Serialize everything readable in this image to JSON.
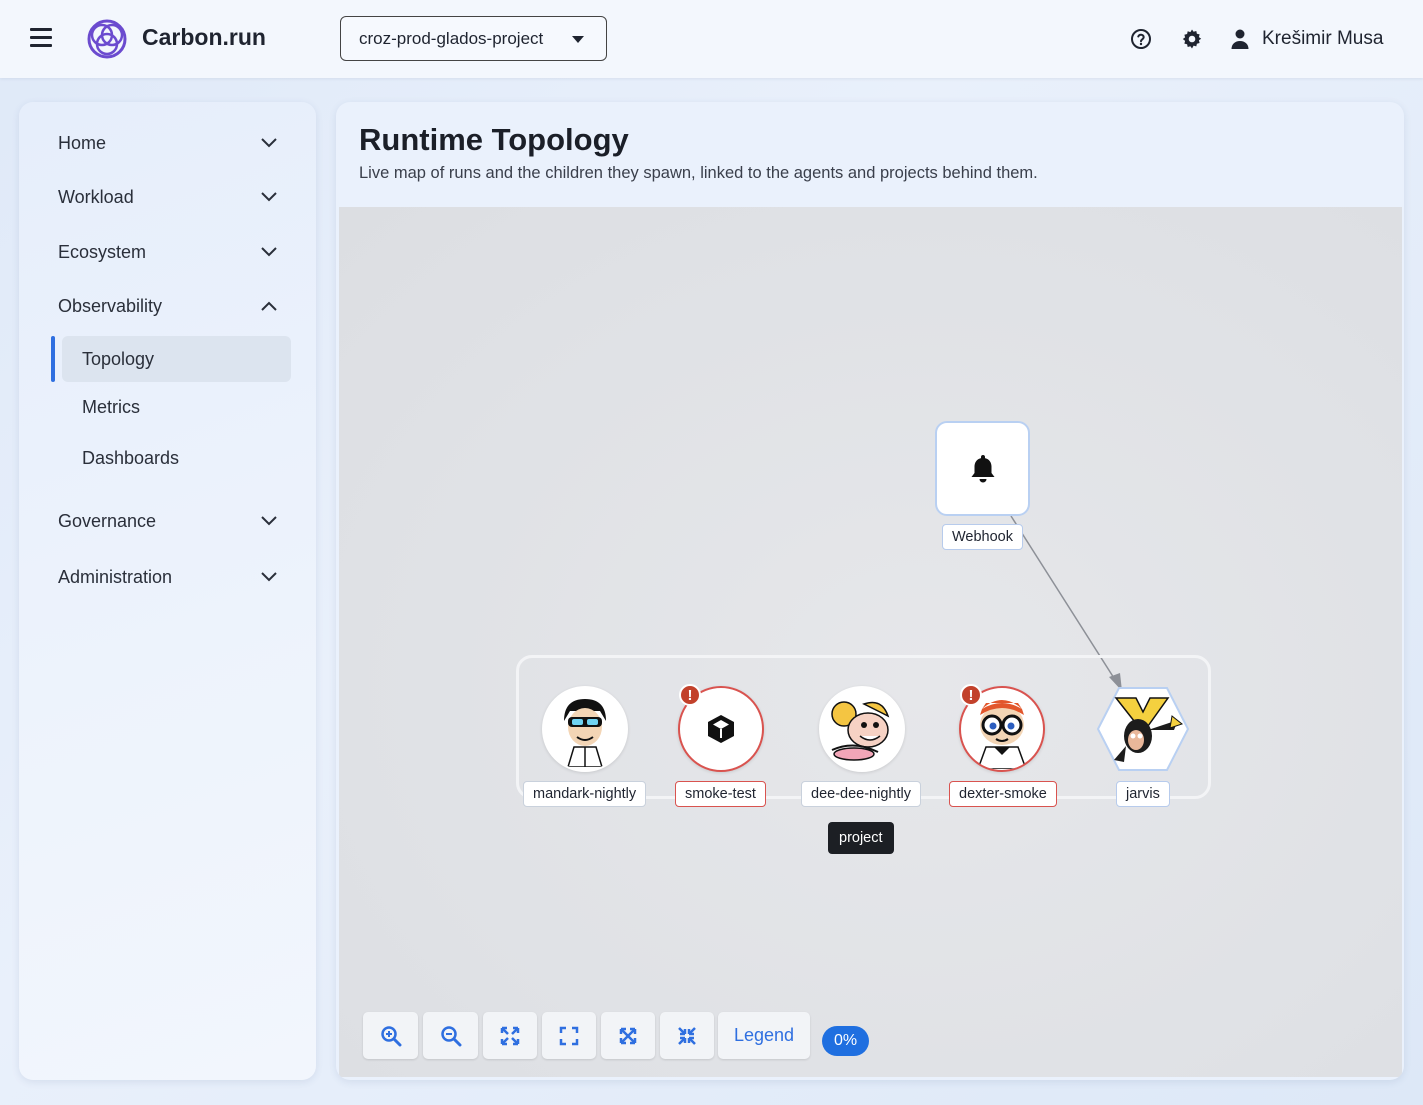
{
  "header": {
    "brand": "Carbon.run",
    "project": "croz-prod-glados-project",
    "username": "Krešimir Musa"
  },
  "sidebar": {
    "items": [
      {
        "label": "Home",
        "expanded": false
      },
      {
        "label": "Workload",
        "expanded": false
      },
      {
        "label": "Ecosystem",
        "expanded": false
      },
      {
        "label": "Observability",
        "expanded": true
      },
      {
        "label": "Governance",
        "expanded": false
      },
      {
        "label": "Administration",
        "expanded": false
      }
    ],
    "observability_children": [
      {
        "label": "Topology",
        "active": true
      },
      {
        "label": "Metrics",
        "active": false
      },
      {
        "label": "Dashboards",
        "active": false
      }
    ]
  },
  "main": {
    "title": "Runtime Topology",
    "subtitle": "Live map of runs and the children they spawn, linked to the agents and projects behind them."
  },
  "topology": {
    "webhook": {
      "label": "Webhook",
      "icon": "bell-icon"
    },
    "nodes": [
      {
        "label": "mandark-nightly",
        "status": "ok"
      },
      {
        "label": "smoke-test",
        "status": "error",
        "icon": "cube-icon"
      },
      {
        "label": "dee-dee-nightly",
        "status": "ok"
      },
      {
        "label": "dexter-smoke",
        "status": "error"
      },
      {
        "label": "jarvis",
        "status": "ok",
        "shape": "hexagon"
      }
    ],
    "tooltip": "project",
    "error_badge": "!"
  },
  "controls": {
    "legend": "Legend",
    "zoom": "0%"
  },
  "colors": {
    "accent": "#2f6fe0",
    "error": "#d9534f"
  }
}
